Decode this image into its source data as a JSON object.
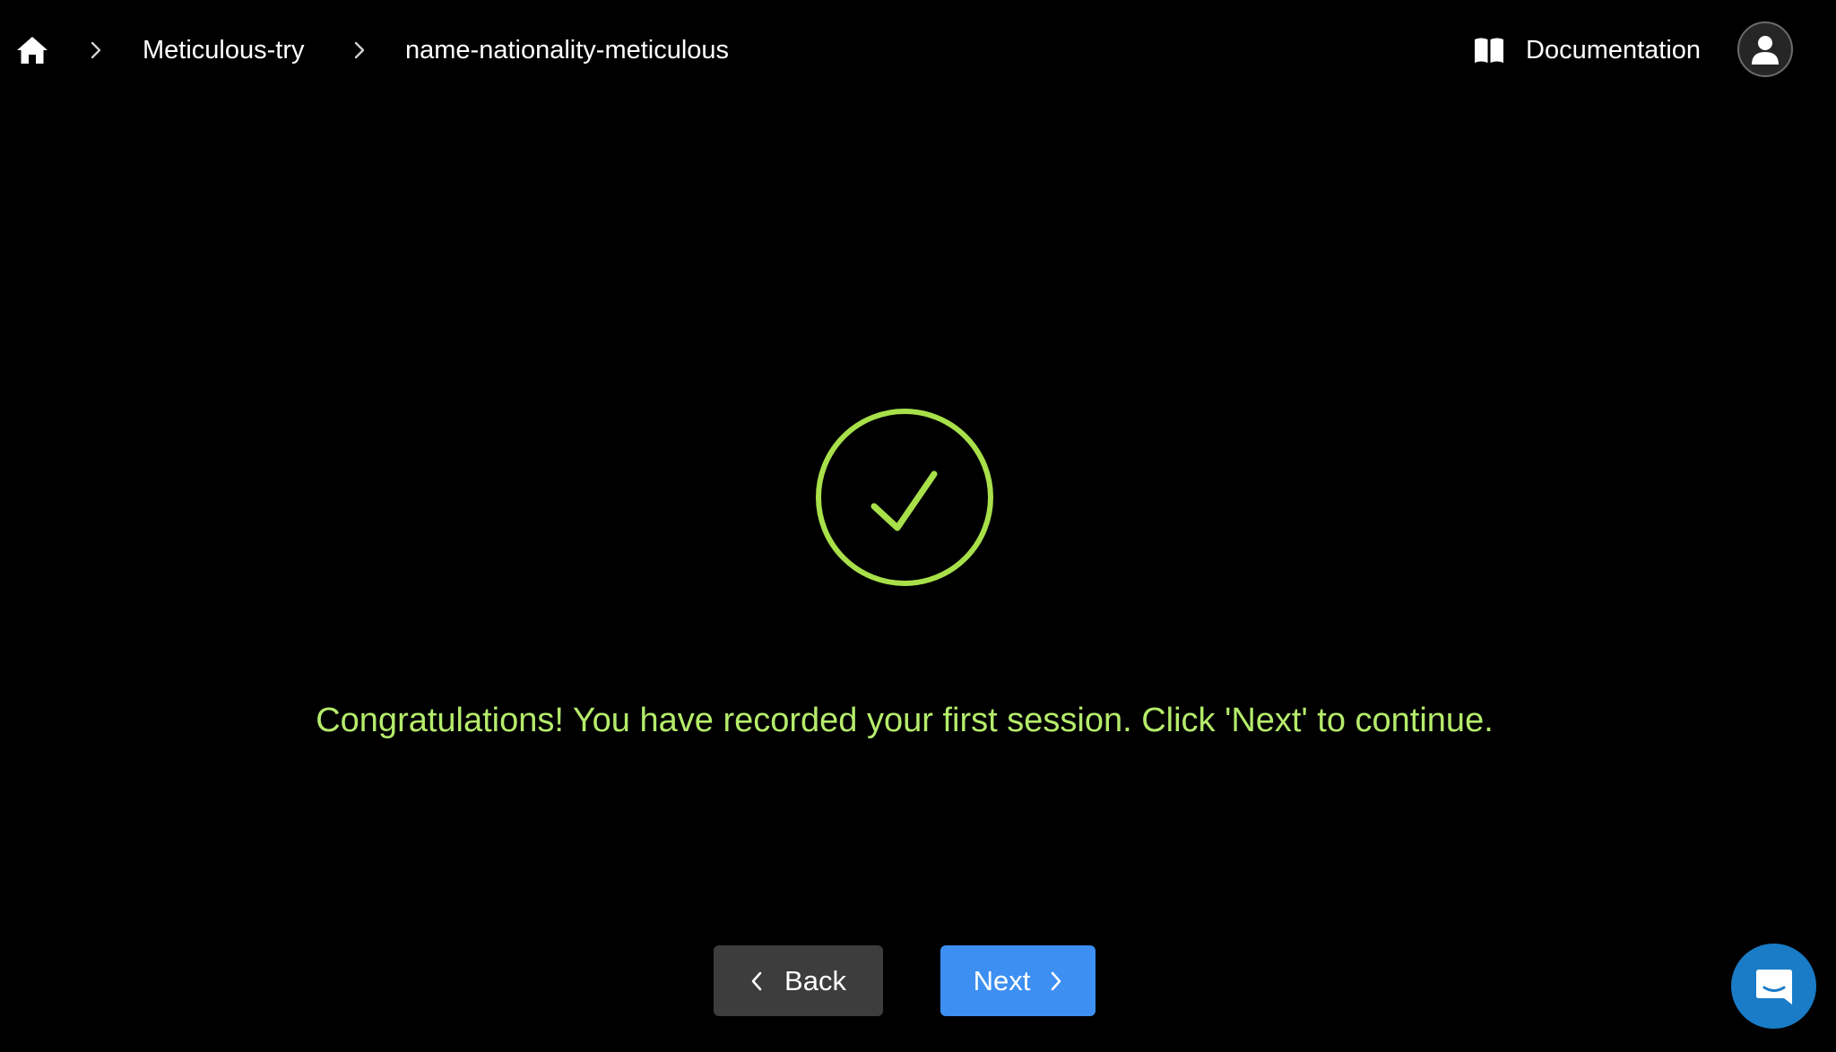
{
  "breadcrumb": {
    "items": [
      {
        "label": "Meticulous-try"
      },
      {
        "label": "name-nationality-meticulous"
      }
    ]
  },
  "header": {
    "docs_label": "Documentation"
  },
  "success": {
    "message": "Congratulations! You have recorded your first session. Click 'Next' to continue."
  },
  "actions": {
    "back_label": "Back",
    "next_label": "Next"
  },
  "icons": {
    "home": "home-icon",
    "separator": "chevron-right-icon",
    "docs": "book-icon",
    "avatar": "user-icon",
    "success": "check-circle-icon",
    "chat": "chat-icon"
  },
  "colors": {
    "background": "#000000",
    "success_green": "#a8e04a",
    "message_green": "#b5ec6b",
    "next_button": "#3d8ff2",
    "back_button": "#3d3d3d",
    "chat_launcher": "#1a7cc7"
  }
}
